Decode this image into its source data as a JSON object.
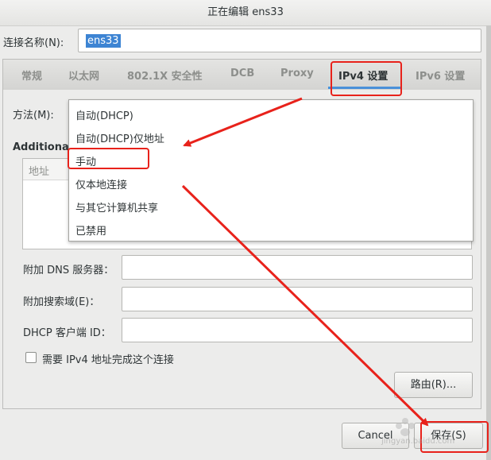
{
  "window": {
    "title": "正在编辑 ens33"
  },
  "connection": {
    "label": "连接名称(N):",
    "value": "ens33"
  },
  "tabs": [
    {
      "label": "常规"
    },
    {
      "label": "以太网"
    },
    {
      "label": "802.1X 安全性"
    },
    {
      "label": "DCB"
    },
    {
      "label": "Proxy"
    },
    {
      "label": "IPv4 设置",
      "active": true
    },
    {
      "label": "IPv6 设置"
    }
  ],
  "method": {
    "label": "方法(M):",
    "options": [
      "自动(DHCP)",
      "自动(DHCP)仅地址",
      "手动",
      "仅本地连接",
      "与其它计算机共享",
      "已禁用"
    ]
  },
  "additional": {
    "heading": "Additiona",
    "address_header": "地址"
  },
  "fields": {
    "dns_label": "附加 DNS 服务器：",
    "search_label": "附加搜索域(E)：",
    "dhcp_label": "DHCP 客户端 ID："
  },
  "checkbox": {
    "label": "需要 IPv4 地址完成这个连接",
    "checked": false
  },
  "buttons": {
    "routes": "路由(R)...",
    "cancel": "Cancel",
    "save": "保存(S)"
  },
  "watermark": {
    "text": "jingyan.baidu.com"
  },
  "colors": {
    "annotation": "#e8221b",
    "selection": "#3d84d3",
    "tab_accent": "#4a90d9"
  }
}
